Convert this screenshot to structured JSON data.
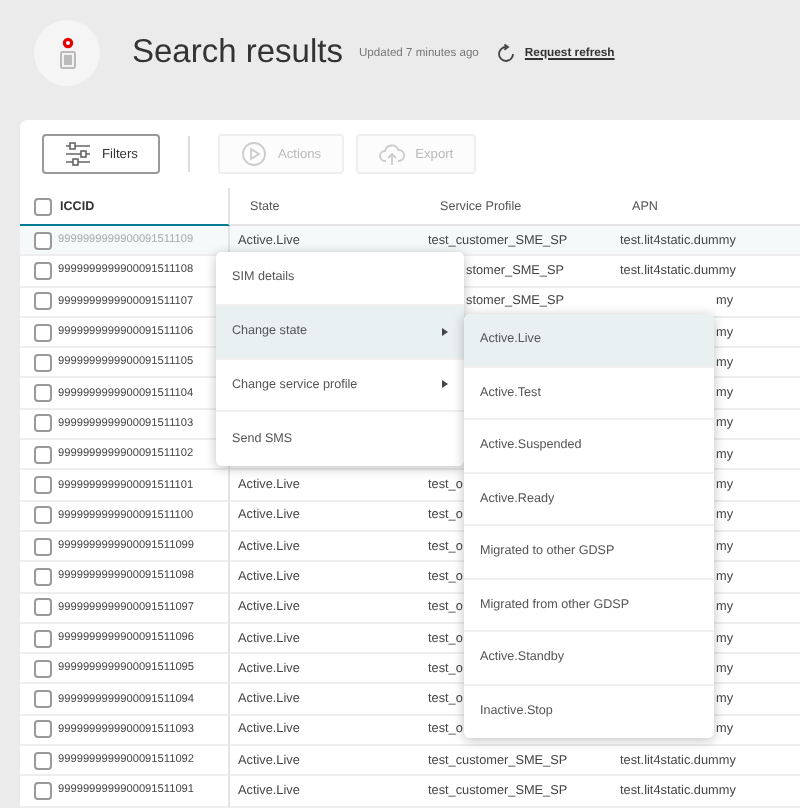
{
  "header": {
    "title": "Search results",
    "updated": "Updated 7 minutes ago",
    "refresh_link": "Request refresh"
  },
  "toolbar": {
    "buttons": [
      {
        "kind": "filters",
        "label": "Filters",
        "disabled": false
      },
      {
        "kind": "actions",
        "label": "Actions",
        "disabled": true
      },
      {
        "kind": "export",
        "label": "Export",
        "disabled": true
      }
    ]
  },
  "table": {
    "header_checked": false,
    "columns": [
      {
        "label": "ICCID",
        "sorted": true
      },
      {
        "label": "State",
        "sorted": false
      },
      {
        "label": "Service Profile",
        "sorted": false
      },
      {
        "label": "APN",
        "sorted": false
      }
    ],
    "rows": [
      {
        "iccid": "9999999999900091511109",
        "checked": false,
        "highlighted": true,
        "state": "Active.Live",
        "service_profile": "test_customer_SME_SP",
        "apn": "test.lit4static.dummy"
      },
      {
        "iccid": "9999999999900091511108",
        "checked": false,
        "highlighted": false,
        "service_profile": "stomer_SME_SP",
        "service_profile_cut": true,
        "apn": "test.lit4static.dummy"
      },
      {
        "iccid": "9999999999900091511107",
        "checked": false,
        "highlighted": false,
        "service_profile": "stomer_SME_SP",
        "service_profile_cut": true,
        "apn": "my",
        "apn_cut": true
      },
      {
        "iccid": "9999999999900091511106",
        "checked": false,
        "highlighted": false,
        "apn": "my",
        "apn_cut": true
      },
      {
        "iccid": "9999999999900091511105",
        "checked": false,
        "highlighted": false,
        "apn": "my",
        "apn_cut": true
      },
      {
        "iccid": "9999999999900091511104",
        "checked": false,
        "highlighted": false,
        "apn": "my",
        "apn_cut": true
      },
      {
        "iccid": "9999999999900091511103",
        "checked": false,
        "highlighted": false,
        "apn": "my",
        "apn_cut": true
      },
      {
        "iccid": "9999999999900091511102",
        "checked": false,
        "highlighted": false,
        "apn": "my",
        "apn_cut": true
      },
      {
        "iccid": "9999999999900091511101",
        "checked": false,
        "highlighted": false,
        "state": "Active.Live",
        "service_profile": "test_o",
        "apn": "my",
        "apn_cut": true
      },
      {
        "iccid": "9999999999900091511100",
        "checked": false,
        "highlighted": false,
        "state": "Active.Live",
        "service_profile": "test_o",
        "apn": "my",
        "apn_cut": true
      },
      {
        "iccid": "9999999999900091511099",
        "checked": false,
        "highlighted": false,
        "state": "Active.Live",
        "service_profile": "test_o",
        "apn": "my",
        "apn_cut": true
      },
      {
        "iccid": "9999999999900091511098",
        "checked": false,
        "highlighted": false,
        "state": "Active.Live",
        "service_profile": "test_o",
        "apn": "my",
        "apn_cut": true
      },
      {
        "iccid": "9999999999900091511097",
        "checked": false,
        "highlighted": false,
        "state": "Active.Live",
        "service_profile": "test_o",
        "apn": "my",
        "apn_cut": true
      },
      {
        "iccid": "9999999999900091511096",
        "checked": false,
        "highlighted": false,
        "state": "Active.Live",
        "service_profile": "test_o",
        "apn": "my",
        "apn_cut": true
      },
      {
        "iccid": "9999999999900091511095",
        "checked": false,
        "highlighted": false,
        "state": "Active.Live",
        "service_profile": "test_o",
        "apn": "my",
        "apn_cut": true
      },
      {
        "iccid": "9999999999900091511094",
        "checked": false,
        "highlighted": false,
        "state": "Active.Live",
        "service_profile": "test_o",
        "apn": "my",
        "apn_cut": true
      },
      {
        "iccid": "9999999999900091511093",
        "checked": false,
        "highlighted": false,
        "state": "Active.Live",
        "service_profile": "test_o",
        "apn": "my",
        "apn_cut": true
      },
      {
        "iccid": "9999999999900091511092",
        "checked": false,
        "highlighted": false,
        "state": "Active.Live",
        "service_profile": "test_customer_SME_SP",
        "apn": "test.lit4static.dummy"
      },
      {
        "iccid": "9999999999900091511091",
        "checked": false,
        "highlighted": false,
        "state": "Active.Live",
        "service_profile": "test_customer_SME_SP",
        "apn": "test.lit4static.dummy"
      }
    ]
  },
  "context_menu": {
    "items": [
      {
        "label": "SIM details",
        "has_submenu": false,
        "selected": false
      },
      {
        "label": "Change state",
        "has_submenu": true,
        "selected": true
      },
      {
        "label": "Change service profile",
        "has_submenu": true,
        "selected": false
      },
      {
        "label": "Send SMS",
        "has_submenu": false,
        "selected": false
      }
    ]
  },
  "submenu": {
    "items": [
      {
        "label": "Active.Live",
        "selected": true
      },
      {
        "label": "Active.Test",
        "selected": false
      },
      {
        "label": "Active.Suspended",
        "selected": false
      },
      {
        "label": "Active.Ready",
        "selected": false
      },
      {
        "label": "Migrated to other GDSP",
        "selected": false
      },
      {
        "label": "Migrated from other GDSP",
        "selected": false
      },
      {
        "label": "Active.Standby",
        "selected": false
      },
      {
        "label": "Inactive.Stop",
        "selected": false
      }
    ]
  }
}
